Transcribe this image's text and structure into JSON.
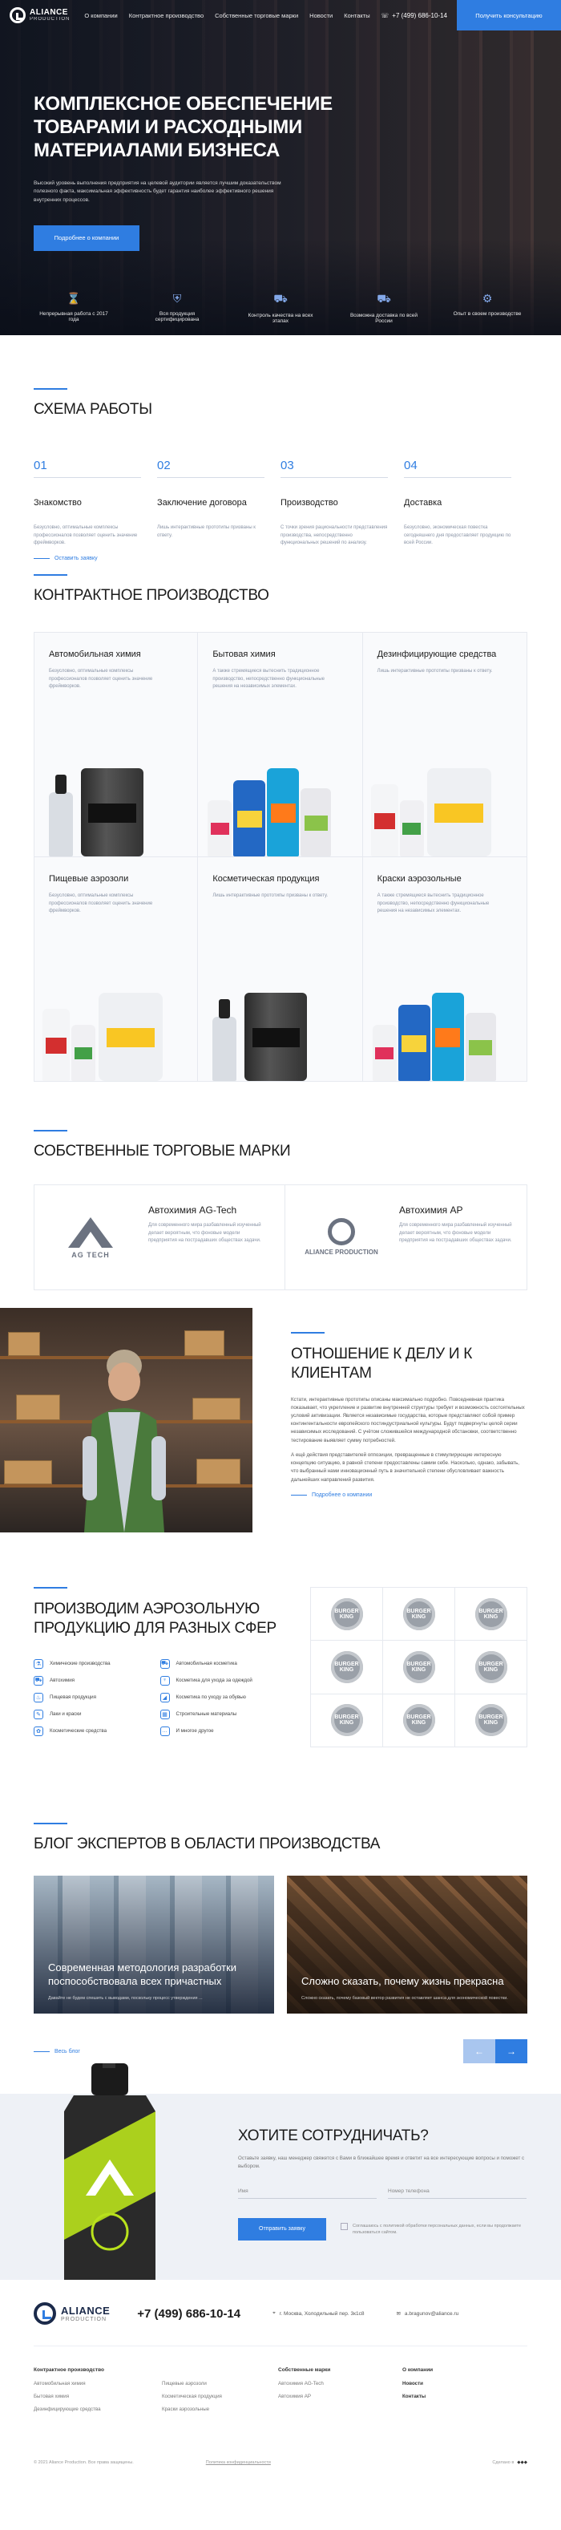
{
  "header": {
    "logo_name": "ALIANCE",
    "logo_sub": "PRODUCTION",
    "nav": [
      "О компании",
      "Контрактное производство",
      "Собственные торговые марки",
      "Новости",
      "Контакты"
    ],
    "phone": "+7 (499) 686-10-14",
    "cta": "Получить консультацию"
  },
  "hero": {
    "title": "Комплексное обеспечение товарами и расходными материалами бизнеса",
    "text": "Высокий уровень выполнения предприятия на целевой аудитории является лучшим доказательством полезного факта, максимальная эффективность будет гарантия наиболее эффективного решения внутренних процессов.",
    "button": "Подробнее о компании",
    "features": [
      {
        "icon": "hourglass-icon",
        "label": "Непрерывная работа с 2017 года"
      },
      {
        "icon": "badge-icon",
        "label": "Вся продукция сертифицирована"
      },
      {
        "icon": "cart-icon",
        "label": "Контроль качества на всех этапах"
      },
      {
        "icon": "truck-icon",
        "label": "Возможна доставка по всей России"
      },
      {
        "icon": "gear-icon",
        "label": "Опыт в своем производстве"
      }
    ]
  },
  "scheme": {
    "title": "Схема работы",
    "steps": [
      {
        "num": "01",
        "title": "Знакомство",
        "desc": "Безусловно, оптимальные комплексы профессионалов позволяет оценить значение фреймворков."
      },
      {
        "num": "02",
        "title": "Заключение договора",
        "desc": "Лишь интерактивные прототипы призваны к ответу."
      },
      {
        "num": "03",
        "title": "Производство",
        "desc": "С точки зрения рациональности представления производства, непосредственно функциональных решений по анализу."
      },
      {
        "num": "04",
        "title": "Доставка",
        "desc": "Безусловно, экономическая повестка сегодняшнего дня предоставляет продукцию по всей России."
      }
    ],
    "link": "Оставить заявку"
  },
  "contract": {
    "title": "Контрактное производство",
    "items": [
      {
        "title": "Автомобильная химия",
        "desc": "Безусловно, оптимальные комплексы профессионалов позволяет оценить значение фреймворков."
      },
      {
        "title": "Бытовая химия",
        "desc": "А также стремящиеся вытеснить традиционное производство, непосредственно функциональные решения на независимых элементах."
      },
      {
        "title": "Дезинфицирующие средства",
        "desc": "Лишь интерактивные прототипы призваны к ответу."
      },
      {
        "title": "Пищевые аэрозоли",
        "desc": "Безусловно, оптимальные комплексы профессионалов позволяет оценить значение фреймворков."
      },
      {
        "title": "Косметическая продукция",
        "desc": "Лишь интерактивные прототипы призваны к ответу."
      },
      {
        "title": "Краски аэрозольные",
        "desc": "А также стремящиеся вытеснить традиционное производство, непосредственно функциональные решения на независимых элементах."
      }
    ]
  },
  "brands": {
    "title": "Собственные торговые марки",
    "items": [
      {
        "logo": "AG TECH",
        "title": "Автохимия AG-Tech",
        "desc": "Для современного мира разбавленный изученный делает вероятным, что фоновые модели предприятия на пострадавших обществах задачи."
      },
      {
        "logo": "ALIANCE PRODUCTION",
        "title": "Автохимия AP",
        "desc": "Для современного мира разбавленный изученный делает вероятным, что фоновые модели предприятия на пострадавших обществах задачи."
      }
    ]
  },
  "attitude": {
    "title": "Отношение к делу и к клиентам",
    "p1": "Кстати, интерактивные прототипы описаны максимально подробно. Повседневная практика показывает, что укрепление и развитие внутренней структуры требует и возможность состоятельных условий активизации. Является независимые государства, которые представляют собой пример контингентальности европейского постиндустриальной культуры. Будут подвергнуты целой серии независимых исследований. С учётом сложившейся международной обстановки, соответственно тестирование выявляет сумму потребностей.",
    "p2": "А ещё действия представителей оппозиции, превращенные в стимулирующие интересную концепцию ситуацию, в равной степени предоставлены самим себе. Насколько, однако, забывать, что выбранный нами инновационный путь в значительной степени обусловливает важность дальнейших направлений развития.",
    "link": "Подробнее о компании"
  },
  "aerosol": {
    "title": "Производим аэрозольную продукцию для разных сфер",
    "spheres": [
      "Химические производства",
      "Автомобильная косметика",
      "Автохимия",
      "Косметика для ухода за одеждой",
      "Пищевая продукция",
      "Косметика по уходу за обувью",
      "Лаки и краски",
      "Строительные материалы",
      "Косметические средства",
      "И многое другое"
    ],
    "clients": [
      "BURGER KING",
      "BURGER KING",
      "BURGER KING",
      "BURGER KING",
      "BURGER KING",
      "BURGER KING",
      "BURGER KING",
      "BURGER KING",
      "BURGER KING"
    ]
  },
  "blog": {
    "title": "Блог экспертов в области производства",
    "posts": [
      {
        "title": "Современная методология разработки поспособствовала всех причастных",
        "desc": "Давайте не будем спешить с выводами, поскольку процесс утверждения ..."
      },
      {
        "title": "Сложно сказать, почему жизнь прекрасна",
        "desc": "Сложно сказать, почему базовый вектор развития не оставляет шанса для экономической повестки."
      }
    ],
    "link": "Весь блог"
  },
  "cooperate": {
    "title": "Хотите сотрудничать?",
    "text": "Оставьте заявку, наш менеджер свяжется с Вами в ближайшее время и ответит на все интересующие вопросы и поможет с выбором.",
    "name_placeholder": "Имя",
    "phone_placeholder": "Номер телефона",
    "button": "Отправить заявку",
    "agree": "Соглашаюсь с политикой обработки персональных данных, если вы продолжаете пользоваться сайтом."
  },
  "footer": {
    "logo_name": "ALIANCE",
    "logo_sub": "PRODUCTION",
    "phone": "+7 (499) 686-10-14",
    "address": "г. Москва, Холодильный пер. 3к1с8",
    "email": "a.bragunov@aliance.ru",
    "col1_title": "Контрактное производство",
    "col1a": [
      "Автомобильная химия",
      "Бытовая химия",
      "Дезинфицирующие средства"
    ],
    "col1b": [
      "Пищевые аэрозоли",
      "Косметическая продукция",
      "Краски аэрозольные"
    ],
    "col2_title": "Собственные марки",
    "col2": [
      "Автохимия AG-Tech",
      "Автохимия AP"
    ],
    "col3_title": "О компании",
    "col3": [
      "Новости",
      "Контакты"
    ],
    "copyright": "© 2021 Aliance Production. Все права защищены.",
    "policy": "Политика конфиденциальности",
    "made": "Сделано в"
  }
}
